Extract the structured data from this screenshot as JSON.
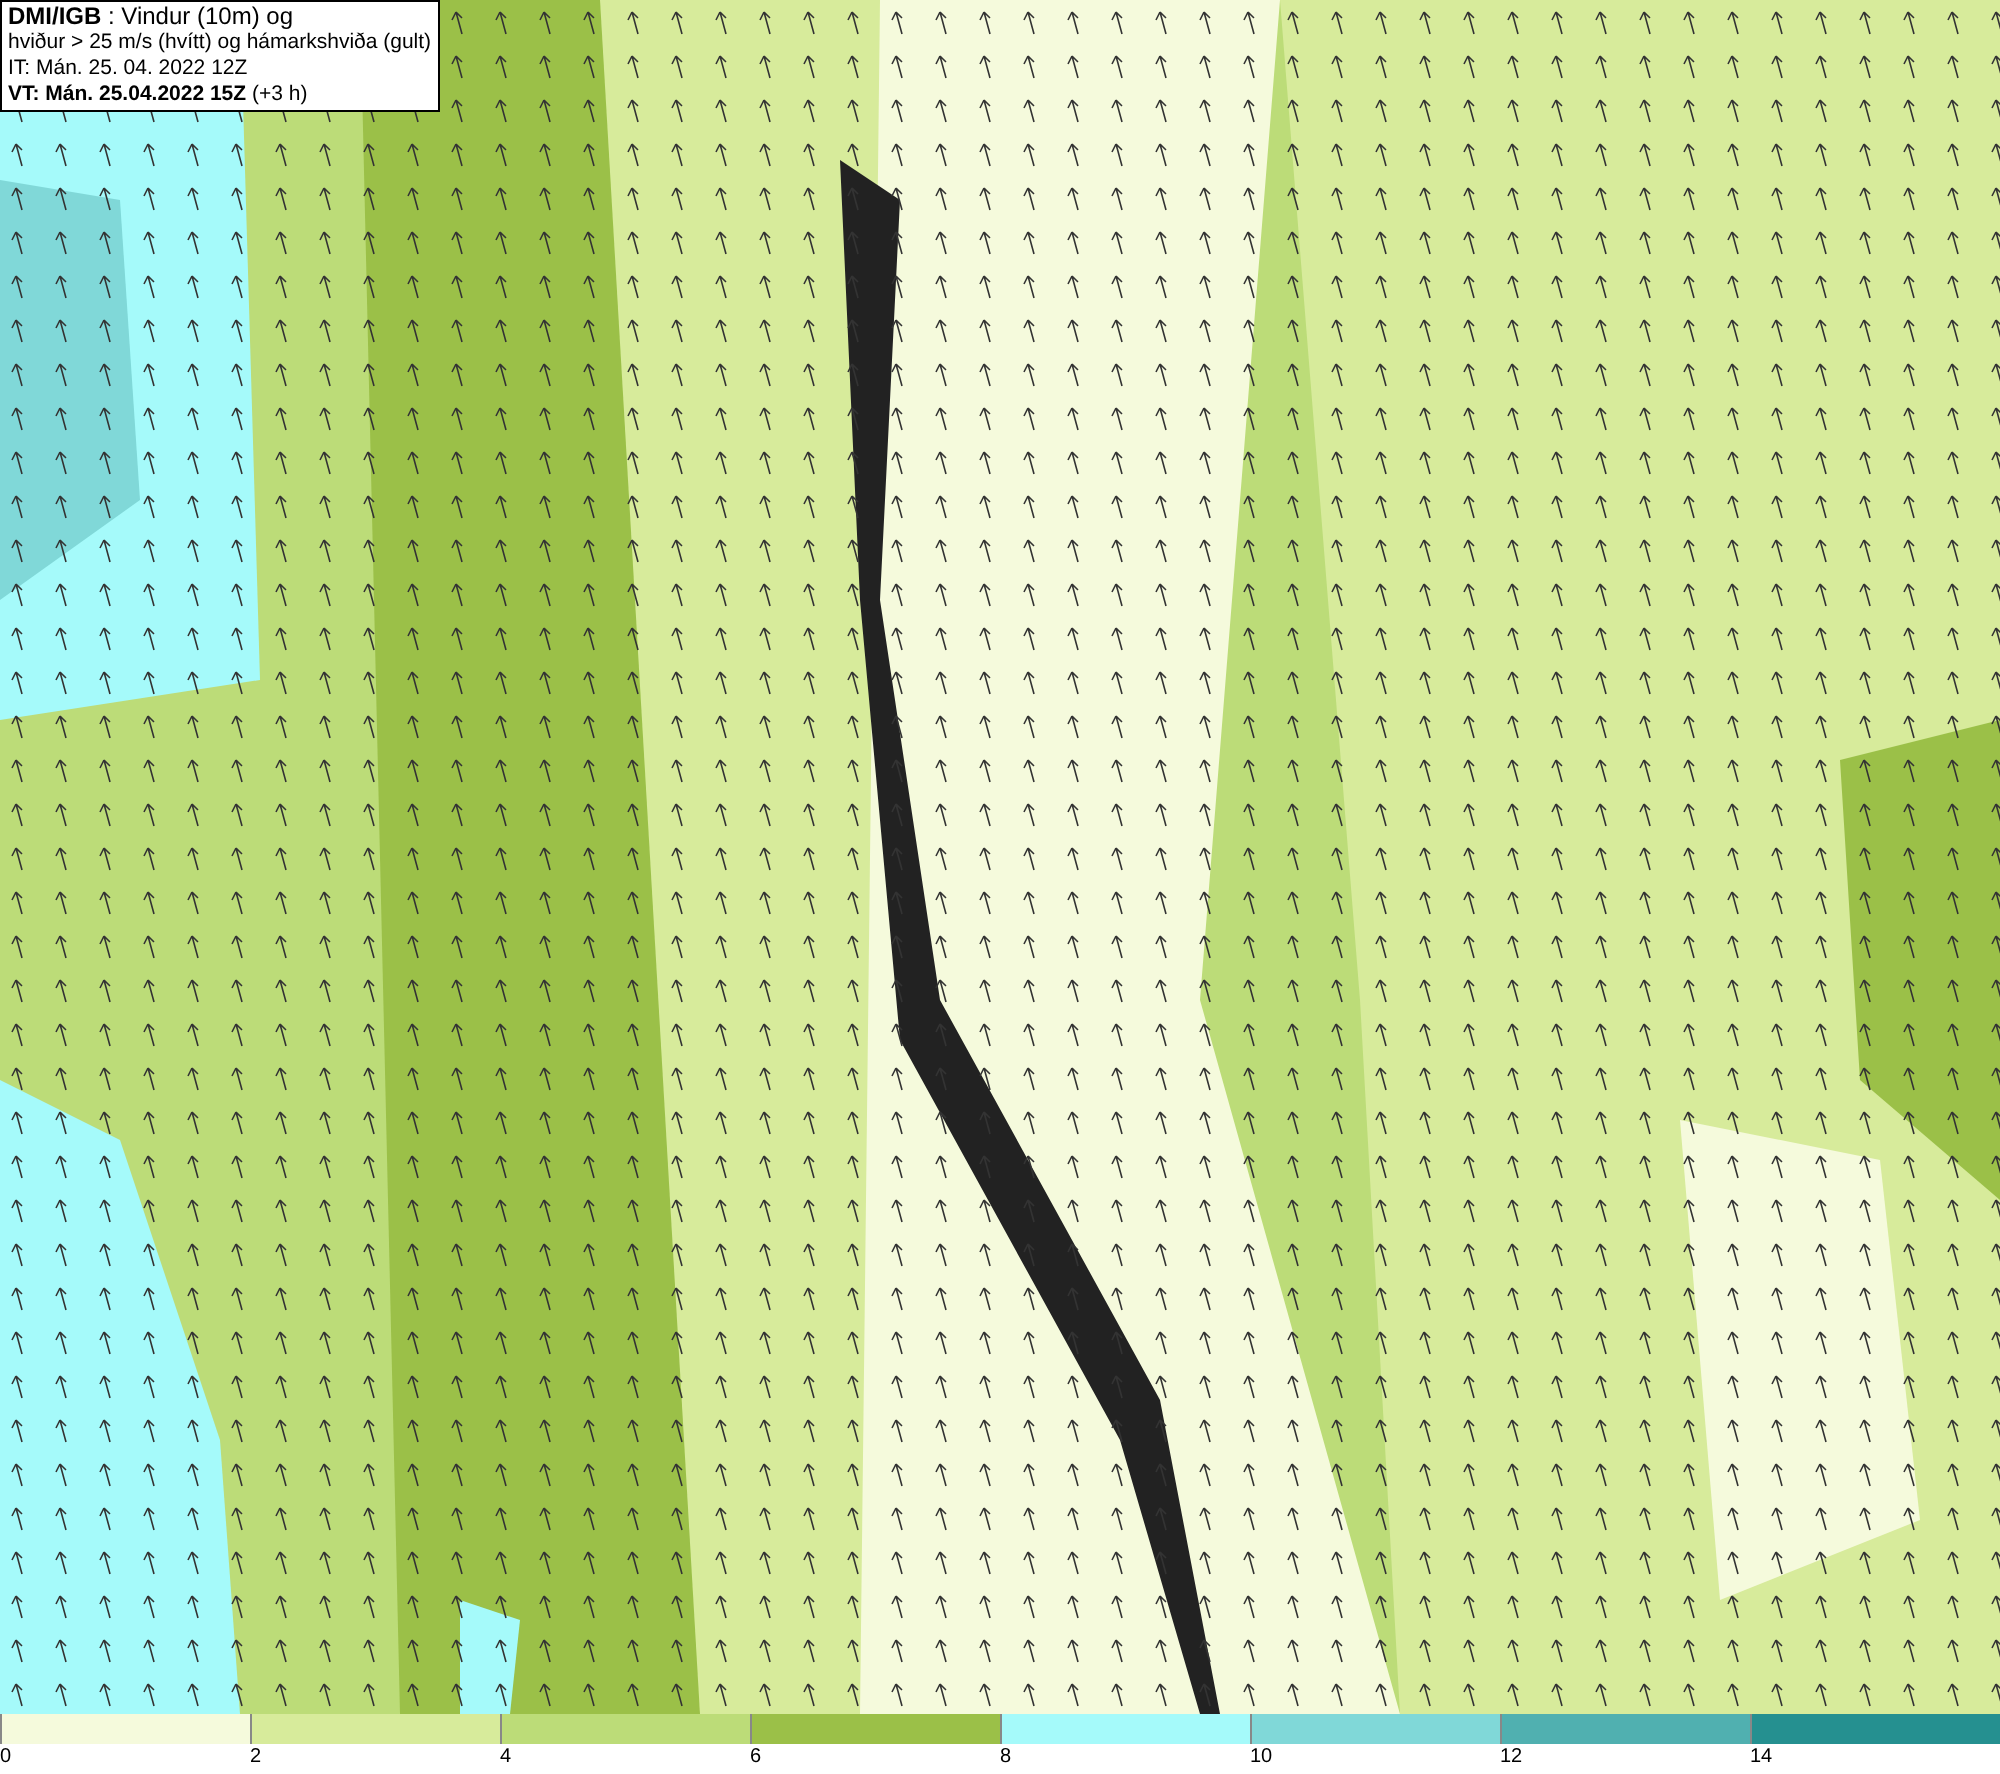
{
  "header": {
    "lines": [
      "**DMI/IGB** : Vindur (10m) og",
      "hviður > 25 m/s (hvítt) og hámarkshviða (gult)",
      "IT: Mán. 25. 04. 2022 12Z",
      "**VT: Mán. 25.04.2022 15Z** (+3 h)"
    ]
  },
  "legend": [
    {
      "label": "0",
      "color": "#f5fadc"
    },
    {
      "label": "2",
      "color": "#d7eb9b"
    },
    {
      "label": "4",
      "color": "#bcdc78"
    },
    {
      "label": "6",
      "color": "#9bc048"
    },
    {
      "label": "8",
      "color": "#a5fafa"
    },
    {
      "label": "10",
      "color": "#80d8d8"
    },
    {
      "label": "12",
      "color": "#50b0b0"
    },
    {
      "label": "14",
      "color": "#259090"
    }
  ]
}
